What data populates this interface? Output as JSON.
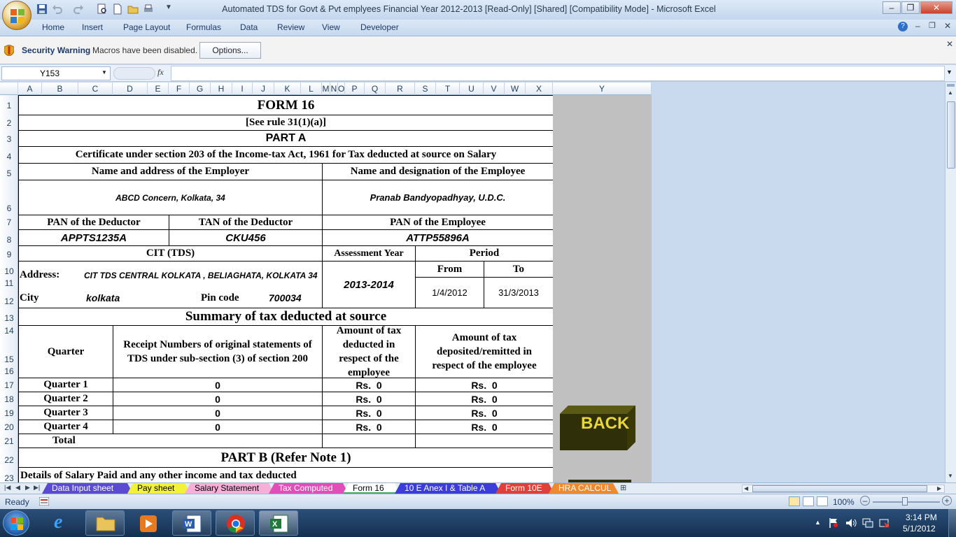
{
  "window": {
    "title": "Automated TDS for Govt & Pvt emplyees  Financial Year 2012-2013  [Read-Only]  [Shared]  [Compatibility Mode] - Microsoft Excel",
    "minimize": "–",
    "restore": "❐",
    "close": "✕"
  },
  "ribbon": {
    "tabs": [
      "Home",
      "Insert",
      "Page Layout",
      "Formulas",
      "Data",
      "Review",
      "View",
      "Developer"
    ]
  },
  "security": {
    "title": "Security Warning",
    "message": "Macros have been disabled.",
    "options": "Options..."
  },
  "formula": {
    "namebox": "Y153",
    "fx": "fx",
    "value": ""
  },
  "columns": [
    "A",
    "B",
    "C",
    "D",
    "E",
    "F",
    "G",
    "H",
    "I",
    "J",
    "K",
    "L",
    "M",
    "N",
    "O",
    "P",
    "Q",
    "R",
    "S",
    "T",
    "U",
    "V",
    "W",
    "X",
    "Y"
  ],
  "rows": [
    "1",
    "2",
    "3",
    "4",
    "5",
    "6",
    "7",
    "8",
    "9",
    "10",
    "11",
    "12",
    "13",
    "14",
    "15",
    "16",
    "17",
    "18",
    "19",
    "20",
    "21",
    "22",
    "23"
  ],
  "form": {
    "title": "FORM 16",
    "rule": "[See rule 31(1)(a)]",
    "part_a": "PART A",
    "certificate": "Certificate under section 203 of the Income-tax Act, 1961 for Tax deducted at source on Salary",
    "employer_hdr": "Name and address of the Employer",
    "employee_hdr": "Name and designation of the Employee",
    "employer": "ABCD Concern, Kolkata, 34",
    "employee": "Pranab Bandyopadhyay, U.D.C.",
    "pan_deductor_hdr": "PAN of the Deductor",
    "tan_deductor_hdr": "TAN of the Deductor",
    "pan_employee_hdr": "PAN of the Employee",
    "pan_deductor": "APPTS1235A",
    "tan_deductor": "CKU456",
    "pan_employee": "ATTP55896A",
    "cit_hdr": "CIT (TDS)",
    "ay_hdr": "Assessment Year",
    "period_hdr": "Period",
    "from_hdr": "From",
    "to_hdr": "To",
    "address_lbl": "Address:",
    "address": "CIT TDS CENTRAL KOLKATA , BELIAGHATA, KOLKATA 34",
    "city_lbl": "City",
    "city": "kolkata",
    "pin_lbl": "Pin code",
    "pin": "700034",
    "ay": "2013-2014",
    "from": "1/4/2012",
    "to": "31/3/2013",
    "summary": "Summary of tax deducted at source",
    "quarter_hdr": "Quarter",
    "receipt_hdr": "Receipt Numbers of original statements of TDS under sub-section (3) of section 200",
    "deducted_hdr": "Amount of tax deducted in respect of the employee",
    "deposited_hdr": "Amount of tax deposited/remitted in respect of the employee",
    "quarters": [
      {
        "name": "Quarter 1",
        "receipt": "0",
        "deducted": "Rs.  0",
        "deposited": "Rs.  0"
      },
      {
        "name": "Quarter 2",
        "receipt": "0",
        "deducted": "Rs.  0",
        "deposited": "Rs.  0"
      },
      {
        "name": "Quarter 3",
        "receipt": "0",
        "deducted": "Rs.  0",
        "deposited": "Rs.  0"
      },
      {
        "name": "Quarter 4",
        "receipt": "0",
        "deducted": "Rs.  0",
        "deposited": "Rs.  0"
      }
    ],
    "total": "Total",
    "part_b": "PART B (Refer Note 1)",
    "details": "Details of Salary Paid and any other income and tax deducted"
  },
  "back_button": "BACK",
  "sheet_tabs": [
    {
      "label": "Data Input sheet",
      "color": "#5a4bd0",
      "text": "#ffffff"
    },
    {
      "label": "Pay sheet",
      "color": "#f2f23a",
      "text": "#000000"
    },
    {
      "label": "Salary Statement",
      "color": "#f6b0d8",
      "text": "#000000"
    },
    {
      "label": "Tax Computed",
      "color": "#e04fb8",
      "text": "#ffffff"
    },
    {
      "label": "Form 16",
      "color": "#ffffff",
      "text": "#000000"
    },
    {
      "label": "10 E Anex I & Table A",
      "color": "#3c3cd8",
      "text": "#ffffff"
    },
    {
      "label": "Form 10E",
      "color": "#e0403a",
      "text": "#ffffff"
    },
    {
      "label": "HRA CALCUL",
      "color": "#f08a30",
      "text": "#ffffff"
    }
  ],
  "status": {
    "ready": "Ready",
    "zoom": "100%"
  },
  "taskbar": {
    "time": "3:14 PM",
    "date": "5/1/2012"
  }
}
